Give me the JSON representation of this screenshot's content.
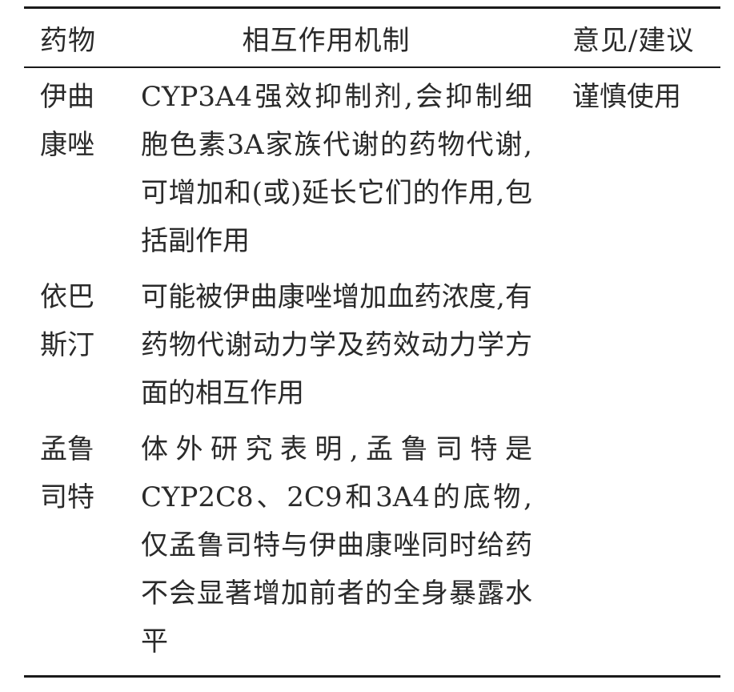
{
  "table": {
    "headers": {
      "drug": "药物",
      "mechanism": "相互作用机制",
      "advice": "意见/建议"
    },
    "rows": [
      {
        "drug": "伊曲康唑",
        "mechanism": "CYP3A4强效抑制剂,会抑制细胞色素3A家族代谢的药物代谢,可增加和(或)延长它们的作用,包括副作用",
        "advice": "谨慎使用"
      },
      {
        "drug": "依巴斯汀",
        "mechanism": "可能被伊曲康唑增加血药浓度,有药物代谢动力学及药效动力学方面的相互作用",
        "advice": ""
      },
      {
        "drug": "孟鲁司特",
        "mechanism": "体外研究表明,孟鲁司特是CYP2C8、2C9和3A4的底物,仅孟鲁司特与伊曲康唑同时给药不会显著增加前者的全身暴露水平",
        "advice": ""
      }
    ]
  }
}
